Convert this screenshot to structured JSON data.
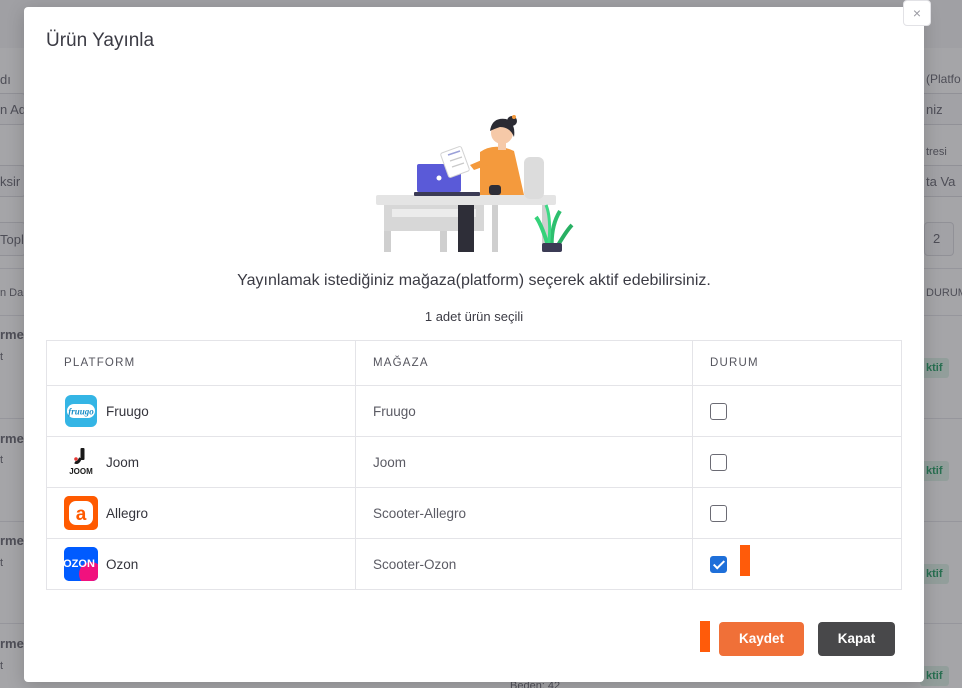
{
  "background": {
    "left_fragments": [
      "dı",
      "n Ad",
      "ksir",
      "Topl",
      "n Da",
      "rmez",
      "t",
      "rmez",
      "t",
      "rmez",
      "t",
      "rmez",
      "t"
    ],
    "right_fragments": [
      "(Platfo",
      "niz",
      "tresi",
      "ta Va",
      "2",
      "DURUM",
      "ktif",
      "ktif",
      "ktif",
      "ktif"
    ],
    "bottom_fragment": "Beden: 42"
  },
  "modal": {
    "title": "Ürün Yayınla",
    "close_label": "×",
    "subtitle": "Yayınlamak istediğiniz mağaza(platform) seçerek aktif edebilirsiniz.",
    "selected_count": "1 adet ürün seçili",
    "table": {
      "headers": [
        "PLATFORM",
        "MAĞAZA",
        "DURUM"
      ],
      "rows": [
        {
          "platform": "Fruugo",
          "store": "Fruugo",
          "logo": "fruugo-logo",
          "logo_text": "fruugo",
          "checked": false
        },
        {
          "platform": "Joom",
          "store": "Joom",
          "logo": "joom-logo",
          "logo_text": "JOOM",
          "checked": false
        },
        {
          "platform": "Allegro",
          "store": "Scooter-Allegro",
          "logo": "allegro-logo",
          "logo_text": "a",
          "checked": false
        },
        {
          "platform": "Ozon",
          "store": "Scooter-Ozon",
          "logo": "ozon-logo",
          "logo_text": "OZON",
          "checked": true
        }
      ]
    },
    "buttons": {
      "save": "Kaydet",
      "close": "Kapat"
    }
  },
  "colors": {
    "save_button": "#f07038",
    "close_button": "#48484a",
    "checkbox_checked": "#1e6fd9",
    "annotation_marker": "#ff5b0a"
  }
}
